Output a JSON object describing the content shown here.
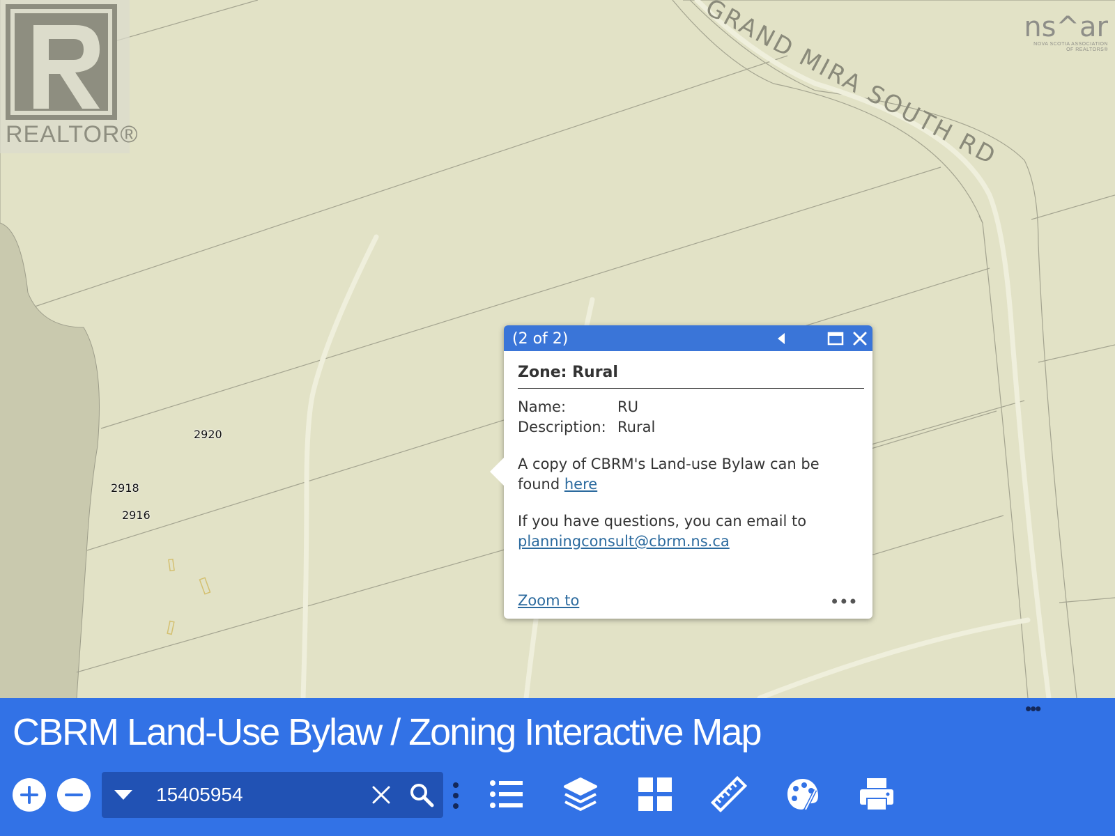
{
  "map": {
    "road_label": "GRAND MIRA SOUTH RD",
    "addresses": [
      "2920",
      "2918",
      "2916"
    ]
  },
  "logos": {
    "realtor_text": "REALTOR®",
    "nsar_text": "ns^ar",
    "nsar_sub1": "NOVA SCOTIA ASSOCIATION",
    "nsar_sub2": "OF REALTORS®"
  },
  "popup": {
    "count": "(2 of 2)",
    "title": "Zone: Rural",
    "name_label": "Name:",
    "name_value": "RU",
    "desc_label": "Description:",
    "desc_value": "Rural",
    "bylaw_text": "A copy of CBRM's Land-use Bylaw can be found ",
    "bylaw_link": "here",
    "question_text": "If you have questions, you can email to",
    "email": "planningconsult@cbrm.ns.ca",
    "zoom_link": "Zoom to",
    "more": "•••"
  },
  "toolbar": {
    "more": "•••",
    "title": "CBRM Land-Use Bylaw / Zoning Interactive Map",
    "search_value": "15405954",
    "icons": [
      "plus-icon",
      "minus-icon",
      "dropdown-icon",
      "clear-icon",
      "search-icon",
      "vertical-dots-icon",
      "legend-list-icon",
      "layers-icon",
      "basemap-gallery-icon",
      "measure-ruler-icon",
      "draw-palette-icon",
      "print-icon"
    ],
    "accent": "#3272e6",
    "search_bg": "#2152b4",
    "popup_header": "#3a75d8"
  }
}
